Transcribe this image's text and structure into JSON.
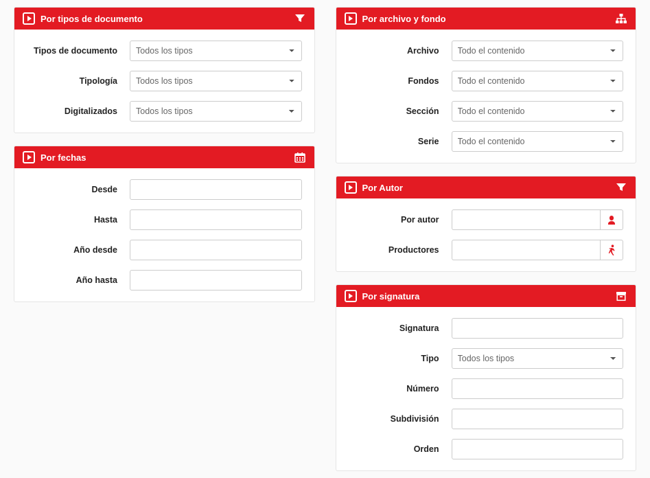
{
  "colors": {
    "accent": "#e31b23"
  },
  "panels": {
    "doc_types": {
      "title": "Por tipos de documento",
      "fields": {
        "tipos_label": "Tipos de documento",
        "tipos_value": "Todos los tipos",
        "tipologia_label": "Tipología",
        "tipologia_value": "Todos los tipos",
        "digitalizados_label": "Digitalizados",
        "digitalizados_value": "Todos los tipos"
      }
    },
    "archive": {
      "title": "Por archivo y fondo",
      "fields": {
        "archivo_label": "Archivo",
        "archivo_value": "Todo el contenido",
        "fondos_label": "Fondos",
        "fondos_value": "Todo el contenido",
        "seccion_label": "Sección",
        "seccion_value": "Todo el contenido",
        "serie_label": "Serie",
        "serie_value": "Todo el contenido"
      }
    },
    "dates": {
      "title": "Por fechas",
      "fields": {
        "desde_label": "Desde",
        "hasta_label": "Hasta",
        "ano_desde_label": "Año desde",
        "ano_hasta_label": "Año hasta"
      }
    },
    "author": {
      "title": "Por Autor",
      "fields": {
        "por_autor_label": "Por autor",
        "productores_label": "Productores"
      }
    },
    "signature": {
      "title": "Por signatura",
      "fields": {
        "signatura_label": "Signatura",
        "tipo_label": "Tipo",
        "tipo_value": "Todos los tipos",
        "numero_label": "Número",
        "subdivision_label": "Subdivisión",
        "orden_label": "Orden"
      }
    }
  }
}
